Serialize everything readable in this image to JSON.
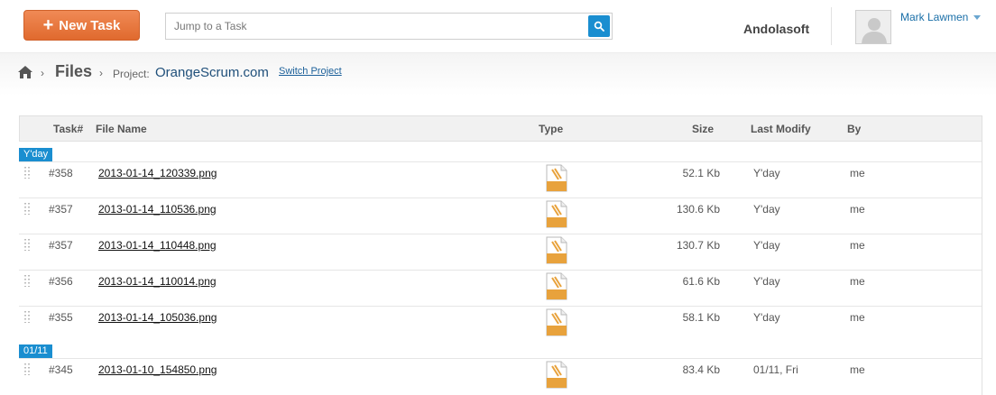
{
  "header": {
    "new_task_label": "New Task",
    "search_placeholder": "Jump to a Task",
    "company": "Andolasoft",
    "user_name": "Mark Lawmen"
  },
  "breadcrumb": {
    "section": "Files",
    "project_label": "Project:",
    "project_name": "OrangeScrum.com",
    "switch_label": "Switch Project"
  },
  "table": {
    "columns": {
      "task": "Task#",
      "file_name": "File Name",
      "type": "Type",
      "size": "Size",
      "last_modify": "Last Modify",
      "by": "By"
    },
    "groups": [
      {
        "label": "Y'day",
        "rows": [
          {
            "task": "#358",
            "file": "2013-01-14_120339.png",
            "type": "PNG",
            "size": "52.1 Kb",
            "modified": "Y'day",
            "by": "me"
          },
          {
            "task": "#357",
            "file": "2013-01-14_110536.png",
            "type": "PNG",
            "size": "130.6 Kb",
            "modified": "Y'day",
            "by": "me"
          },
          {
            "task": "#357",
            "file": "2013-01-14_110448.png",
            "type": "PNG",
            "size": "130.7 Kb",
            "modified": "Y'day",
            "by": "me"
          },
          {
            "task": "#356",
            "file": "2013-01-14_110014.png",
            "type": "PNG",
            "size": "61.6 Kb",
            "modified": "Y'day",
            "by": "me"
          },
          {
            "task": "#355",
            "file": "2013-01-14_105036.png",
            "type": "PNG",
            "size": "58.1 Kb",
            "modified": "Y'day",
            "by": "me"
          }
        ]
      },
      {
        "label": "01/11",
        "rows": [
          {
            "task": "#345",
            "file": "2013-01-10_154850.png",
            "type": "PNG",
            "size": "83.4 Kb",
            "modified": "01/11, Fri",
            "by": "me"
          }
        ]
      }
    ]
  },
  "colors": {
    "accent_orange": "#e8773e",
    "accent_blue": "#1a8ed0",
    "png_icon": "#e8a23c"
  },
  "icons": [
    "plus-icon",
    "search-icon",
    "avatar-icon",
    "caret-down-icon",
    "home-icon",
    "drag-handle-icon",
    "png-file-icon"
  ]
}
